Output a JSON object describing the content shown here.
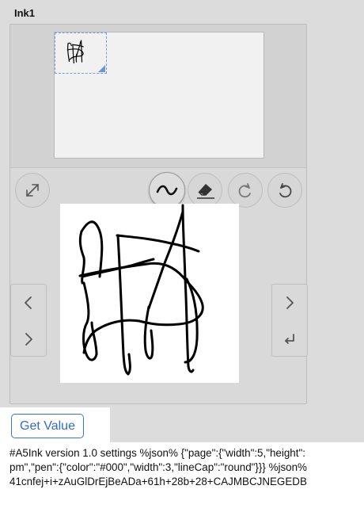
{
  "widget": {
    "title": "Ink1"
  },
  "toolbar": {
    "buttons": [
      {
        "icon": "expand-icon",
        "label": "expand"
      },
      {
        "icon": "pen-icon",
        "label": "pen",
        "active": true
      },
      {
        "icon": "eraser-icon",
        "label": "eraser"
      },
      {
        "icon": "redo-icon",
        "label": "redo"
      },
      {
        "icon": "undo-icon",
        "label": "undo"
      }
    ]
  },
  "navigation": {
    "left": [
      "chevron-left-icon",
      "chevron-right-icon"
    ],
    "right": [
      "chevron-right-icon",
      "enter-icon"
    ]
  },
  "actions": {
    "get_value_label": "Get Value"
  },
  "output": {
    "lines": [
      "#A5Ink version 1.0 settings %json% {\"page\":{\"width\":5,\"height\":",
      "pm\",\"pen\":{\"color\":\"#000\",\"width\":3,\"lineCap\":\"round\"}}} %json%",
      "41cnfej+i+zAuGlDrEjBeADa+61h+28b+28+CAJMBCJNEGEDB"
    ]
  },
  "colors": {
    "accent": "#2f6ec5",
    "ink": "#000000"
  }
}
